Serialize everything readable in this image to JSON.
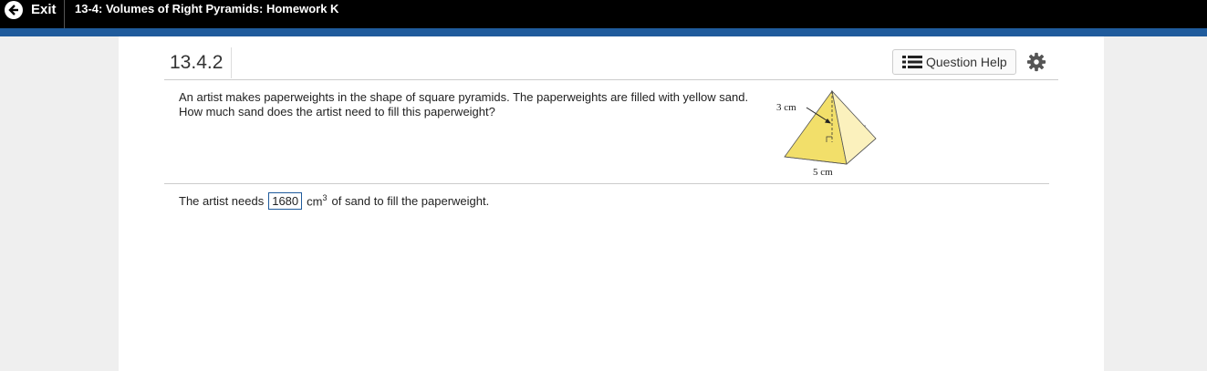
{
  "topbar": {
    "exit_label": "Exit",
    "assignment_title": "13-4: Volumes of Right Pyramids: Homework K"
  },
  "question": {
    "number": "13.4.2",
    "help_label": "Question Help",
    "line1": "An artist makes paperweights in the shape of square pyramids. The paperweights are filled with yellow sand.",
    "line2": "How much sand does the artist need to fill this paperweight?"
  },
  "figure": {
    "height_label": "3 cm",
    "base_label": "5 cm",
    "fill_color": "#f4e37a"
  },
  "answer": {
    "prefix": "The artist needs",
    "value": "1680",
    "unit": "cm",
    "unit_power": "3",
    "suffix": "of sand to fill the paperweight."
  },
  "colors": {
    "topbar": "#000000",
    "accent": "#1f5b9c"
  }
}
